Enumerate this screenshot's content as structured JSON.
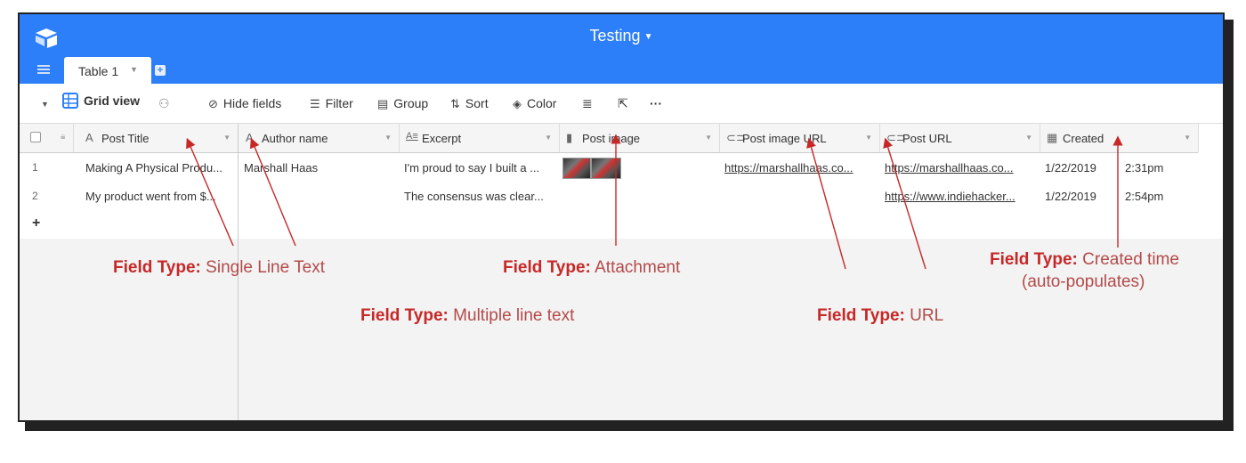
{
  "app": {
    "base_title": "Testing",
    "tab_label": "Table 1"
  },
  "toolbar": {
    "view_name": "Grid view",
    "hide_fields": "Hide fields",
    "filter": "Filter",
    "group": "Group",
    "sort": "Sort",
    "color": "Color",
    "more": "···"
  },
  "columns": [
    {
      "name": "Post Title",
      "icon": "single-line-text-icon"
    },
    {
      "name": "Author name",
      "icon": "single-line-text-icon"
    },
    {
      "name": "Excerpt",
      "icon": "long-text-icon"
    },
    {
      "name": "Post image",
      "icon": "attachment-icon"
    },
    {
      "name": "Post image URL",
      "icon": "url-icon"
    },
    {
      "name": "Post URL",
      "icon": "url-icon"
    },
    {
      "name": "Created",
      "icon": "created-time-icon"
    }
  ],
  "rows": [
    {
      "num": "1",
      "title": "Making A Physical Produ...",
      "author": "Marshall Haas",
      "excerpt": "I'm proud to say I built a ...",
      "image_url": "https://marshallhaas.co...",
      "post_url": "https://marshallhaas.co...",
      "date": "1/22/2019",
      "time": "2:31pm"
    },
    {
      "num": "2",
      "title": "My product went from $...",
      "author": "",
      "excerpt": "The consensus was clear...",
      "image_url": "",
      "post_url": "https://www.indiehacker...",
      "date": "1/22/2019",
      "time": "2:54pm"
    }
  ],
  "add_row": "+",
  "annotations": {
    "label": "Field Type:",
    "single_line": "Single Line Text",
    "attachment": "Attachment",
    "created_1": "Created time",
    "created_2": "(auto-populates)",
    "multi_line": "Multiple line text",
    "url": "URL"
  },
  "colors": {
    "accent": "#2d7ff9",
    "annotation": "#c62828"
  }
}
